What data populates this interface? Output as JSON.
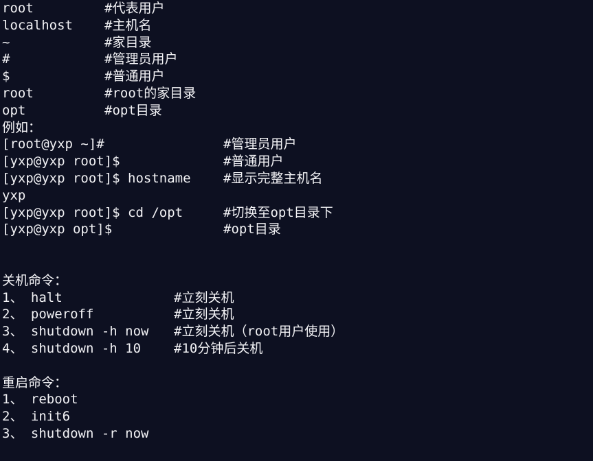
{
  "terminal": {
    "background_color": "#0d1021",
    "text_color": "#f2f2f5",
    "lines": [
      {
        "cmd": "root",
        "note": "#代表用户",
        "col": "col-a"
      },
      {
        "cmd": "localhost",
        "note": "#主机名",
        "col": "col-a"
      },
      {
        "cmd": "~",
        "note": "#家目录",
        "col": "col-a"
      },
      {
        "cmd": "#",
        "note": "#管理员用户",
        "col": "col-a"
      },
      {
        "cmd": "$",
        "note": "#普通用户",
        "col": "col-a"
      },
      {
        "cmd": "root",
        "note": "#root的家目录",
        "col": "col-a"
      },
      {
        "cmd": "opt",
        "note": "#opt目录",
        "col": "col-a"
      },
      {
        "cmd": "例如：",
        "note": "",
        "col": "col-b"
      },
      {
        "cmd": "[root@yxp ~]#",
        "note": "#管理员用户",
        "col": "col-b"
      },
      {
        "cmd": "[yxp@yxp root]$",
        "note": "#普通用户",
        "col": "col-b"
      },
      {
        "cmd": "[yxp@yxp root]$ hostname",
        "note": "#显示完整主机名",
        "col": "col-b"
      },
      {
        "cmd": "yxp",
        "note": "",
        "col": "col-b"
      },
      {
        "cmd": "[yxp@yxp root]$ cd /opt",
        "note": "#切换至opt目录下",
        "col": "col-b"
      },
      {
        "cmd": "[yxp@yxp opt]$",
        "note": "#opt目录",
        "col": "col-b"
      },
      {
        "cmd": "",
        "note": "",
        "col": "col-a"
      },
      {
        "cmd": "",
        "note": "",
        "col": "col-a"
      },
      {
        "cmd": "关机命令：",
        "note": "",
        "col": "col-c"
      },
      {
        "cmd": "1、 halt",
        "note": "#立刻关机",
        "col": "col-c"
      },
      {
        "cmd": "2、 poweroff",
        "note": "#立刻关机",
        "col": "col-c"
      },
      {
        "cmd": "3、 shutdown -h now",
        "note": "#立刻关机（root用户使用）",
        "col": "col-c"
      },
      {
        "cmd": "4、 shutdown -h 10",
        "note": "#10分钟后关机",
        "col": "col-c"
      },
      {
        "cmd": "",
        "note": "",
        "col": "col-a"
      },
      {
        "cmd": "重启命令：",
        "note": "",
        "col": "col-c"
      },
      {
        "cmd": "1、 reboot",
        "note": "",
        "col": "col-c"
      },
      {
        "cmd": "2、 init6",
        "note": "",
        "col": "col-c"
      },
      {
        "cmd": "3、 shutdown -r now",
        "note": "",
        "col": "col-c"
      }
    ]
  }
}
